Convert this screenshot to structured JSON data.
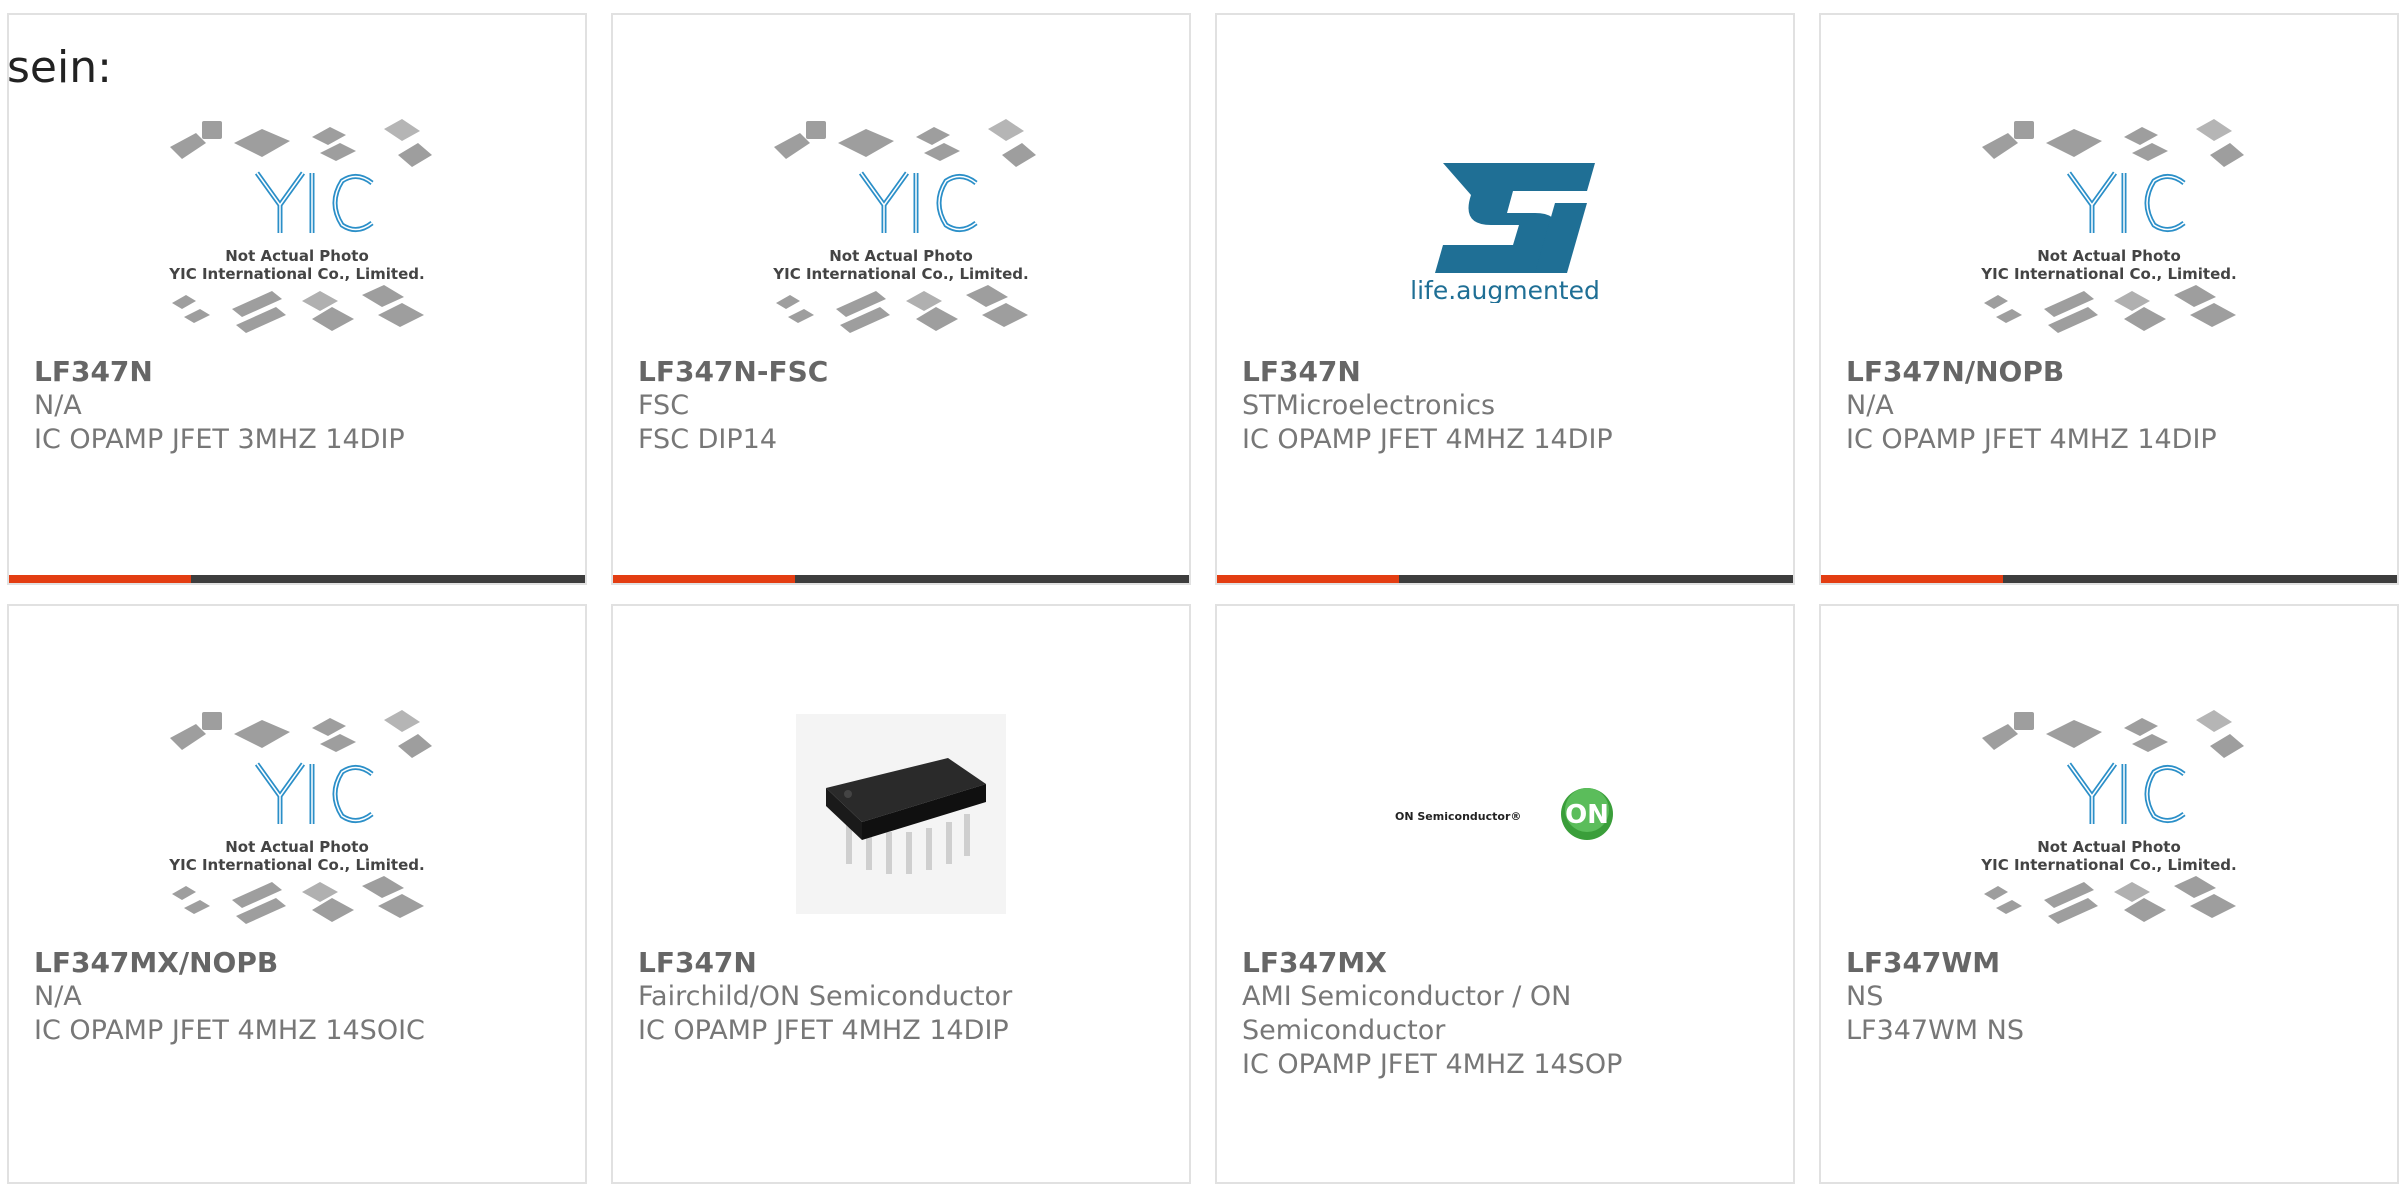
{
  "intro_text": "sein:",
  "placeholder_caption": {
    "line1": "Not Actual Photo",
    "line2": "YIC International Co., Limited.",
    "brand": "YIC"
  },
  "st_logo": {
    "tagline": "life.augmented",
    "mark": "ST"
  },
  "on_logo": {
    "text": "ON Semiconductor®",
    "mark": "ON"
  },
  "cards": [
    {
      "part": "LF347N",
      "maker": "N/A",
      "desc": "IC OPAMP JFET 3MHZ 14DIP",
      "image": "yic-placeholder"
    },
    {
      "part": "LF347N-FSC",
      "maker": "FSC",
      "desc": "FSC DIP14",
      "image": "yic-placeholder"
    },
    {
      "part": "LF347N",
      "maker": "STMicroelectronics",
      "desc": "IC OPAMP JFET 4MHZ 14DIP",
      "image": "st-logo"
    },
    {
      "part": "LF347N/NOPB",
      "maker": "N/A",
      "desc": "IC OPAMP JFET 4MHZ 14DIP",
      "image": "yic-placeholder"
    },
    {
      "part": "LF347MX/NOPB",
      "maker": "N/A",
      "desc": "IC OPAMP JFET 4MHZ 14SOIC",
      "image": "yic-placeholder"
    },
    {
      "part": "LF347N",
      "maker": "Fairchild/ON Semiconductor",
      "desc": "IC OPAMP JFET 4MHZ 14DIP",
      "image": "dip-chip-photo"
    },
    {
      "part": "LF347MX",
      "maker": "AMI Semiconductor / ON Semiconductor",
      "desc": "IC OPAMP JFET 4MHZ 14SOP",
      "image": "on-semi-logo"
    },
    {
      "part": "LF347WM",
      "maker": "NS",
      "desc": "LF347WM NS",
      "image": "yic-placeholder"
    }
  ],
  "colors": {
    "accent": "#e33d12",
    "bar": "#3d3d3d",
    "yic_blue": "#2b8fc8",
    "st_blue": "#1f6f95",
    "on_green": "#3a9e3a"
  }
}
